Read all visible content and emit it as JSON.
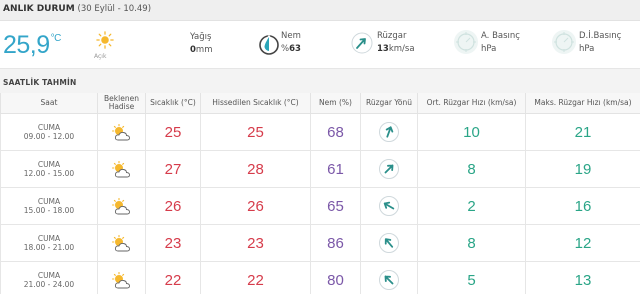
{
  "header": {
    "title": "ANLIK DURUM",
    "date": "(30 Eylül - 10.49)"
  },
  "current": {
    "temperature": "25,9",
    "temp_unit": "°C",
    "condition": "Açık",
    "condition_icon": "sun-icon",
    "rain": {
      "label": "Yağış",
      "value": "0",
      "unit": "mm"
    },
    "humidity": {
      "label": "Nem",
      "prefix": "%",
      "value": "63"
    },
    "wind": {
      "label": "Rüzgar",
      "value": "13",
      "unit": "km/sa"
    },
    "pressure": {
      "label": "A. Basınç",
      "unit": "hPa"
    },
    "sea_pressure": {
      "label": "D.İ.Basınç",
      "unit": "hPa"
    }
  },
  "hourly": {
    "title": "SAATLİK TAHMİN",
    "headers": {
      "time": "Saat",
      "forecast_1": "Beklenen",
      "forecast_2": "Hadise",
      "temp": "Sıcaklık (°C)",
      "feels": "Hissedilen Sıcaklık (°C)",
      "humidity": "Nem (%)",
      "wind_dir": "Rüzgar Yönü",
      "avg_wind": "Ort. Rüzgar Hızı (km/sa)",
      "max_wind": "Maks. Rüzgar Hızı (km/sa)"
    },
    "rows": [
      {
        "day": "CUMA",
        "time": "09.00 - 12.00",
        "temp": "25",
        "feels": "25",
        "humidity": "68",
        "avg_wind": "10",
        "max_wind": "21"
      },
      {
        "day": "CUMA",
        "time": "12.00 - 15.00",
        "temp": "27",
        "feels": "28",
        "humidity": "61",
        "avg_wind": "8",
        "max_wind": "19"
      },
      {
        "day": "CUMA",
        "time": "15.00 - 18.00",
        "temp": "26",
        "feels": "26",
        "humidity": "65",
        "avg_wind": "2",
        "max_wind": "16"
      },
      {
        "day": "CUMA",
        "time": "18.00 - 21.00",
        "temp": "23",
        "feels": "23",
        "humidity": "86",
        "avg_wind": "8",
        "max_wind": "12"
      },
      {
        "day": "CUMA",
        "time": "21.00 - 24.00",
        "temp": "22",
        "feels": "22",
        "humidity": "80",
        "avg_wind": "5",
        "max_wind": "13"
      }
    ]
  },
  "colors": {
    "temp_blue": "#33a5c9",
    "red": "#d63c4b",
    "purple": "#7b58a8",
    "teal": "#2aa587"
  }
}
